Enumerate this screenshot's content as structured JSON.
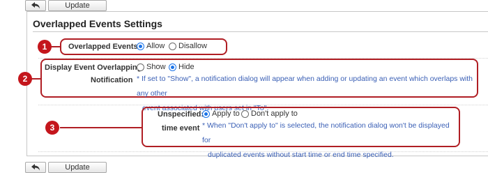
{
  "toolbar": {
    "update_label": "Update"
  },
  "page": {
    "title": "Overlapped Events Settings"
  },
  "section1": {
    "badge": "1",
    "label": "Overlapped Events:",
    "options": [
      {
        "label": "Allow",
        "selected": true
      },
      {
        "label": "Disallow",
        "selected": false
      }
    ]
  },
  "section2": {
    "badge": "2",
    "label_line1": "Display Event Overlapping:",
    "label_line2": "Notification",
    "options": [
      {
        "label": "Show",
        "selected": false
      },
      {
        "label": "Hide",
        "selected": true
      }
    ],
    "note_line1": "* If set to \"Show\", a notification dialog will appear when adding or updating an event which overlaps with any other",
    "note_line2": "event associated with users set in \"To\"."
  },
  "section3": {
    "badge": "3",
    "label_line1": "Unspecified:",
    "label_line2": "time event",
    "options": [
      {
        "label": "Apply to",
        "selected": true
      },
      {
        "label": "Don't apply to",
        "selected": false
      }
    ],
    "note_line1": "* When \"Don't apply to\" is selected, the notification dialog won't be displayed for",
    "note_line2": "duplicated events without start time or end time specified."
  },
  "colors": {
    "accent": "#1a73e8",
    "callout": "#c4161c",
    "note": "#3a5fb5"
  }
}
